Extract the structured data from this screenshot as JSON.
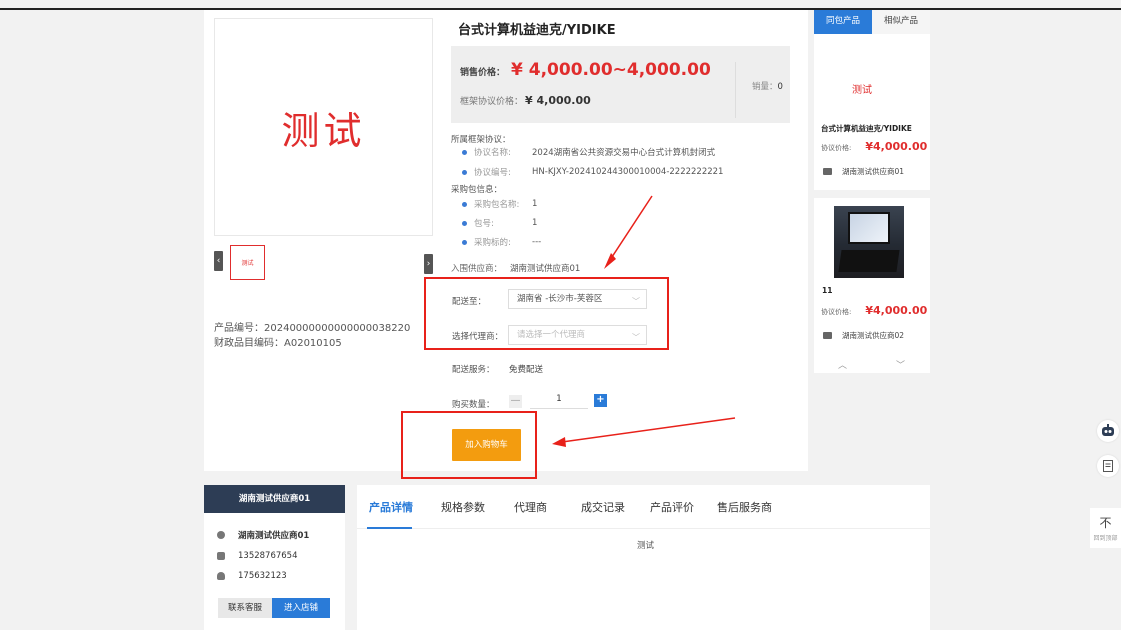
{
  "product": {
    "title": "台式计算机益迪克/YIDIKE",
    "image_text": "测试",
    "thumb_text": "测试",
    "code_label": "产品编号：",
    "code_value": "20240000000000000038220",
    "catalog_label": "财政品目编码：",
    "catalog_value": "A02010105"
  },
  "price": {
    "sale_label": "销售价格：",
    "sale_value": "¥ 4,000.00~4,000.00",
    "framework_label": "框架协议价格：",
    "framework_value": "¥ 4,000.00",
    "sales_label": "销量：",
    "sales_value": "0"
  },
  "agreement": {
    "header": "所属框架协议：",
    "name_label": "协议名称:",
    "name_value": "2024湖南省公共资源交易中心台式计算机封闭式",
    "no_label": "协议编号:",
    "no_value": "HN-KJXY-202410244300010004-2222222221"
  },
  "package": {
    "header": "采购包信息：",
    "pkg_name_label": "采购包名称:",
    "pkg_name_value": "1",
    "pkg_no_label": "包号:",
    "pkg_no_value": "1",
    "purpose_label": "采购标的:",
    "purpose_value": "---"
  },
  "supplier_line": {
    "label": "入围供应商：",
    "value": "湖南测试供应商01"
  },
  "delivery": {
    "to_label": "配送至：",
    "to_value": "湖南省 -长沙市-芙蓉区",
    "agent_label": "选择代理商：",
    "agent_placeholder": "请选择一个代理商",
    "service_label": "配送服务：",
    "service_value": "免费配送",
    "qty_label": "购买数量：",
    "qty_value": "1",
    "minus": "—",
    "plus": "+"
  },
  "cart_button": "加入购物车",
  "side": {
    "tab_same": "同包产品",
    "tab_similar": "相似产品",
    "item1": {
      "image_text": "测试",
      "title": "台式计算机益迪克/YIDIKE",
      "price_label": "协议价格:",
      "price": "¥4,000.00",
      "supplier": "湖南测试供应商01"
    },
    "item2": {
      "title": "11",
      "price_label": "协议价格:",
      "price": "¥4,000.00",
      "supplier": "湖南测试供应商02"
    },
    "up": "︿",
    "down": "﹀"
  },
  "supplier_card": {
    "header": "湖南测试供应商01",
    "name": "湖南测试供应商01",
    "phone": "13528767654",
    "qq": "175632123",
    "contact_btn": "联系客服",
    "store_btn": "进入店铺"
  },
  "tabs": {
    "items": [
      "产品详情",
      "规格参数",
      "代理商",
      "成交记录",
      "产品评价",
      "售后服务商"
    ],
    "content": "测试"
  },
  "floating": {
    "top_label": "回到顶部",
    "top_icon": "不"
  }
}
